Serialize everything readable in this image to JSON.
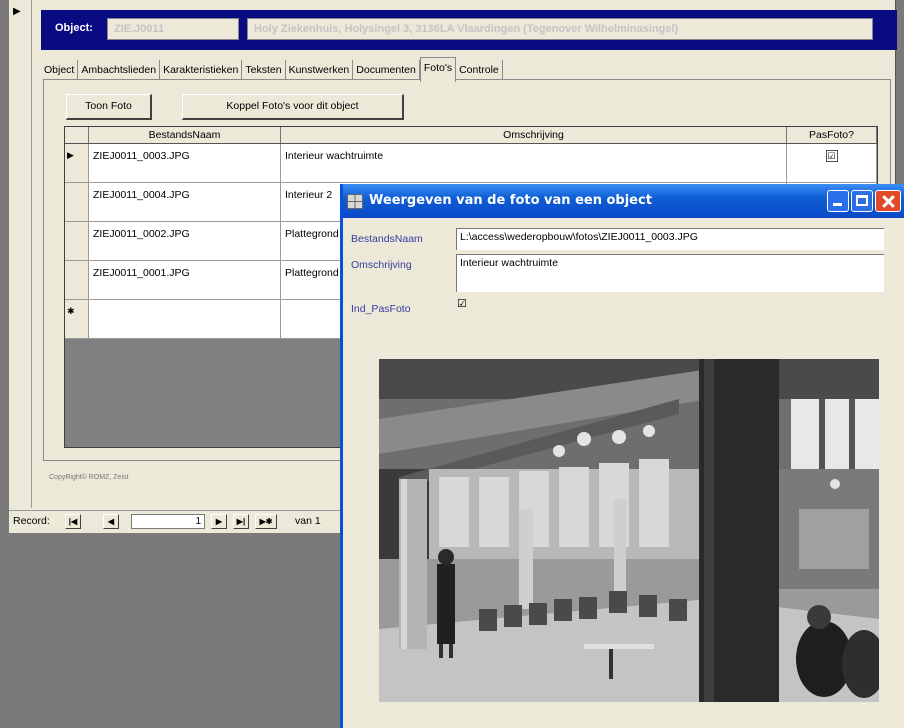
{
  "form": {
    "header": {
      "label": "Object:",
      "object_id": "ZIE.J0011",
      "object_desc": "Holy Ziekenhuis, Holysingel 3, 3136LA Vlaardingen (Tegenover Wilhelminasingel)"
    },
    "tabs": [
      "Object",
      "Ambachtslieden",
      "Karakteristieken",
      "Teksten",
      "Kunstwerken",
      "Documenten",
      "Foto's",
      "Controle"
    ],
    "active_tab": "Foto's",
    "buttons": {
      "toon_foto": "Toon Foto",
      "koppel": "Koppel Foto's voor dit object"
    },
    "grid": {
      "headers": {
        "filename": "BestandsNaam",
        "description": "Omschrijving",
        "pasfoto": "PasFoto?"
      },
      "rows": [
        {
          "selector": "▶",
          "filename": "ZIEJ0011_0003.JPG",
          "description": "Interieur wachtruimte",
          "pasfoto": "☑"
        },
        {
          "selector": "",
          "filename": "ZIEJ0011_0004.JPG",
          "description": "Interieur 2",
          "pasfoto": ""
        },
        {
          "selector": "",
          "filename": "ZIEJ0011_0002.JPG",
          "description": "Plattegrond",
          "pasfoto": ""
        },
        {
          "selector": "",
          "filename": "ZIEJ0011_0001.JPG",
          "description": "Plattegrond",
          "pasfoto": ""
        },
        {
          "selector": "✱",
          "filename": "",
          "description": "",
          "pasfoto": ""
        }
      ]
    },
    "copyright": "CopyRight© ROMZ, Zeist",
    "navigation": {
      "record_label": "Record:",
      "current_record": "1",
      "of_label": "van 1"
    }
  },
  "popup": {
    "title": "Weergeven van de foto van een object",
    "fields": {
      "bestandsnaam_label": "BestandsNaam",
      "bestandsnaam_value": "L:\\access\\wederopbouw\\fotos\\ZIEJ0011_0003.JPG",
      "omschrijving_label": "Omschrijving",
      "omschrijving_value": "Interieur wachtruimte",
      "pasfoto_label": "Ind_PasFoto",
      "pasfoto_value": "☑"
    }
  }
}
